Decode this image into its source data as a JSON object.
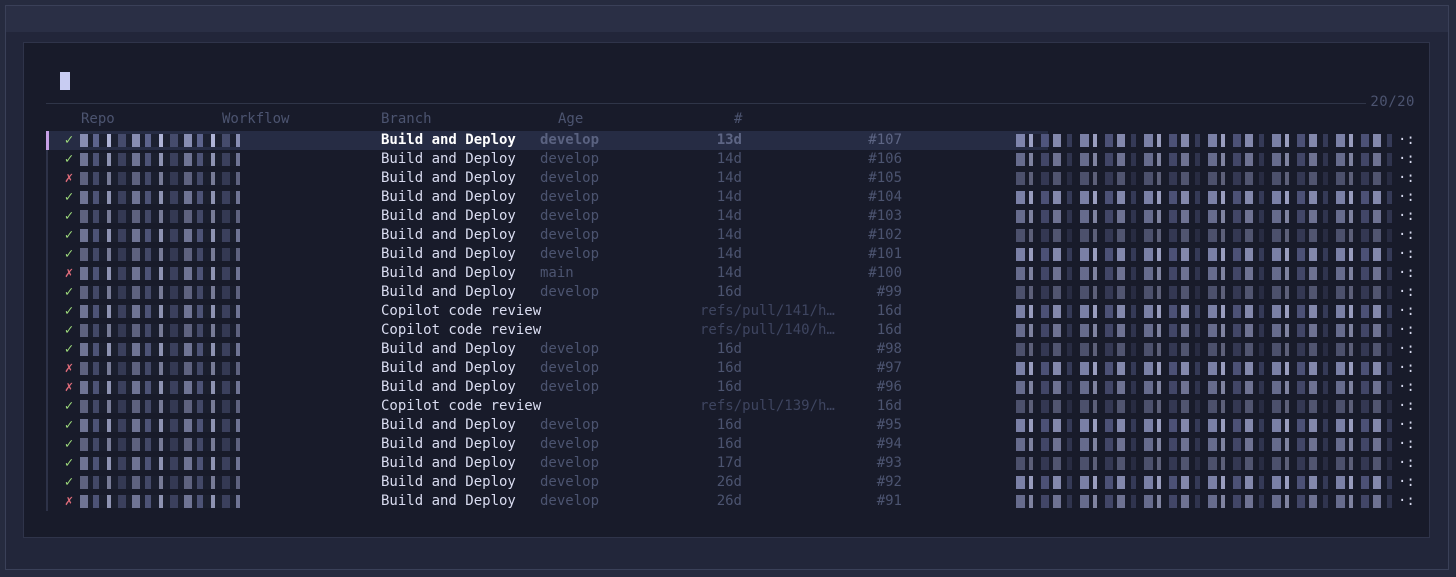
{
  "counter": "20/20",
  "columns": {
    "repo": "Repo",
    "workflow": "Workflow",
    "branch": "Branch",
    "age": "Age",
    "number": "#"
  },
  "ellipsis": "·:",
  "colors": {
    "success": "#9bd67a",
    "failure": "#e06c7a",
    "selection_marker": "#c7a0e6"
  },
  "runs": [
    {
      "status": "✓",
      "state": "ok",
      "workflow": "Build and Deploy",
      "branch": "develop",
      "age": "13d",
      "number": "#107"
    },
    {
      "status": "✓",
      "state": "ok",
      "workflow": "Build and Deploy",
      "branch": "develop",
      "age": "14d",
      "number": "#106"
    },
    {
      "status": "✗",
      "state": "fail",
      "workflow": "Build and Deploy",
      "branch": "develop",
      "age": "14d",
      "number": "#105"
    },
    {
      "status": "✓",
      "state": "ok",
      "workflow": "Build and Deploy",
      "branch": "develop",
      "age": "14d",
      "number": "#104"
    },
    {
      "status": "✓",
      "state": "ok",
      "workflow": "Build and Deploy",
      "branch": "develop",
      "age": "14d",
      "number": "#103"
    },
    {
      "status": "✓",
      "state": "ok",
      "workflow": "Build and Deploy",
      "branch": "develop",
      "age": "14d",
      "number": "#102"
    },
    {
      "status": "✓",
      "state": "ok",
      "workflow": "Build and Deploy",
      "branch": "develop",
      "age": "14d",
      "number": "#101"
    },
    {
      "status": "✗",
      "state": "fail",
      "workflow": "Build and Deploy",
      "branch": "main",
      "age": "14d",
      "number": "#100"
    },
    {
      "status": "✓",
      "state": "ok",
      "workflow": "Build and Deploy",
      "branch": "develop",
      "age": "16d",
      "number": "#99"
    },
    {
      "status": "✓",
      "state": "ok",
      "workflow": "Copilot code review",
      "branch": "refs/pull/141/h…",
      "age": "16d",
      "number": ""
    },
    {
      "status": "✓",
      "state": "ok",
      "workflow": "Copilot code review",
      "branch": "refs/pull/140/h…",
      "age": "16d",
      "number": ""
    },
    {
      "status": "✓",
      "state": "ok",
      "workflow": "Build and Deploy",
      "branch": "develop",
      "age": "16d",
      "number": "#98"
    },
    {
      "status": "✗",
      "state": "fail",
      "workflow": "Build and Deploy",
      "branch": "develop",
      "age": "16d",
      "number": "#97"
    },
    {
      "status": "✗",
      "state": "fail",
      "workflow": "Build and Deploy",
      "branch": "develop",
      "age": "16d",
      "number": "#96"
    },
    {
      "status": "✓",
      "state": "ok",
      "workflow": "Copilot code review",
      "branch": "refs/pull/139/h…",
      "age": "16d",
      "number": ""
    },
    {
      "status": "✓",
      "state": "ok",
      "workflow": "Build and Deploy",
      "branch": "develop",
      "age": "16d",
      "number": "#95"
    },
    {
      "status": "✓",
      "state": "ok",
      "workflow": "Build and Deploy",
      "branch": "develop",
      "age": "16d",
      "number": "#94"
    },
    {
      "status": "✓",
      "state": "ok",
      "workflow": "Build and Deploy",
      "branch": "develop",
      "age": "17d",
      "number": "#93"
    },
    {
      "status": "✓",
      "state": "ok",
      "workflow": "Build and Deploy",
      "branch": "develop",
      "age": "26d",
      "number": "#92"
    },
    {
      "status": "✗",
      "state": "fail",
      "workflow": "Build and Deploy",
      "branch": "develop",
      "age": "26d",
      "number": "#91"
    }
  ]
}
